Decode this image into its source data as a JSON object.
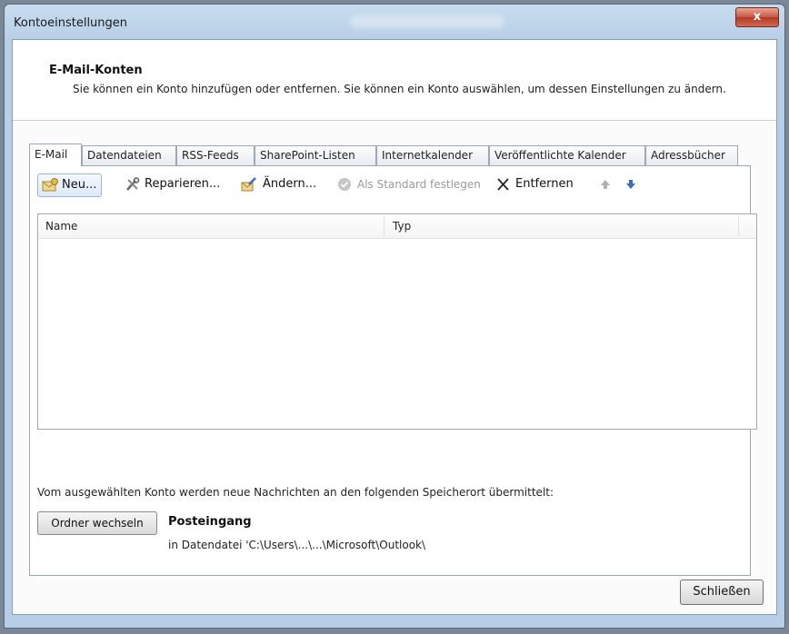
{
  "window": {
    "title": "Kontoeinstellungen",
    "close_glyph": "x"
  },
  "header": {
    "title": "E-Mail-Konten",
    "description": "Sie können ein Konto hinzufügen oder entfernen. Sie können ein Konto auswählen, um dessen Einstellungen zu ändern."
  },
  "tabs": [
    {
      "label": "E-Mail",
      "active": true
    },
    {
      "label": "Datendateien"
    },
    {
      "label": "RSS-Feeds"
    },
    {
      "label": "SharePoint-Listen"
    },
    {
      "label": "Internetkalender"
    },
    {
      "label": "Veröffentlichte Kalender"
    },
    {
      "label": "Adressbücher"
    }
  ],
  "toolbar": {
    "new_label": "Neu...",
    "repair_label": "Reparieren...",
    "change_label": "Ändern...",
    "default_label": "Als Standard festlegen",
    "remove_label": "Entfernen",
    "icons": [
      "mail-new-icon",
      "tools-icon",
      "edit-icon",
      "check-icon",
      "x-icon",
      "arrow-up-icon",
      "arrow-down-icon"
    ]
  },
  "list": {
    "col_name": "Name",
    "col_type": "Typ",
    "rows": []
  },
  "delivery": {
    "info": "Vom ausgewählten Konto werden neue Nachrichten an den folgenden Speicherort übermittelt:",
    "folder_button": "Ordner wechseln",
    "folder": "Posteingang",
    "path": "in Datendatei 'C:\\Users\\...\\...\\Microsoft\\Outlook\\"
  },
  "footer": {
    "close_label": "Schließen"
  },
  "colors": {
    "accent": "#3a6fb5",
    "close_red": "#c75544"
  }
}
